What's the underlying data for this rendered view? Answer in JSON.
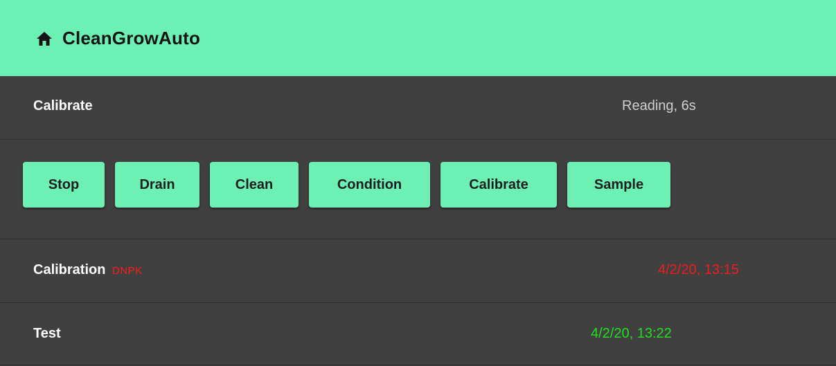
{
  "app": {
    "title": "CleanGrowAuto",
    "home_icon": "home-icon",
    "accent_color": "#6cf0b4"
  },
  "status": {
    "label": "Calibrate",
    "value": "Reading, 6s"
  },
  "actions": [
    {
      "label": "Stop"
    },
    {
      "label": "Drain"
    },
    {
      "label": "Clean"
    },
    {
      "label": "Condition"
    },
    {
      "label": "Calibrate"
    },
    {
      "label": "Sample"
    }
  ],
  "log": [
    {
      "title": "Calibration",
      "tag": "DNPK",
      "time": "4/2/20, 13:15",
      "time_color": "#ee1c1c"
    },
    {
      "title": "Test",
      "tag": "",
      "time": "4/2/20, 13:22",
      "time_color": "#20e020"
    }
  ]
}
